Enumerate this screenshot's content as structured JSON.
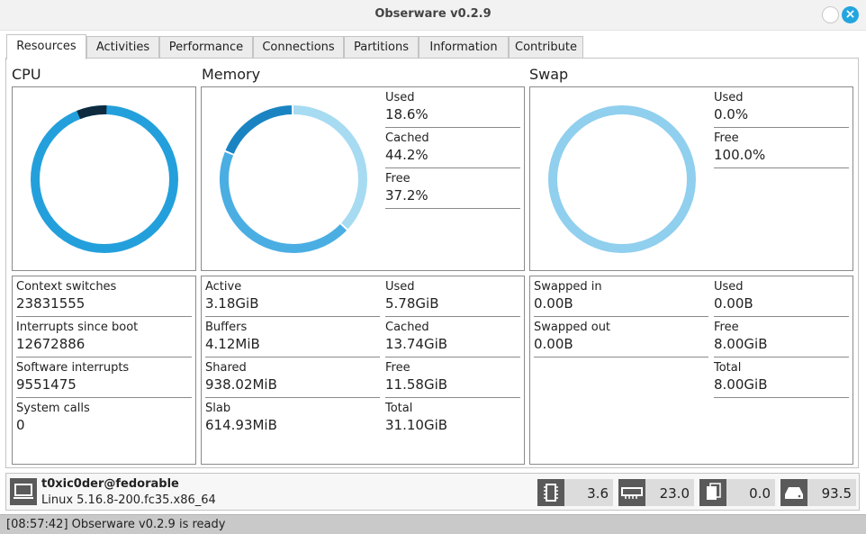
{
  "window": {
    "title": "Obserware v0.2.9",
    "close_glyph": "×"
  },
  "tabs": [
    {
      "label": "Resources",
      "active": true
    },
    {
      "label": "Activities"
    },
    {
      "label": "Performance"
    },
    {
      "label": "Connections"
    },
    {
      "label": "Partitions"
    },
    {
      "label": "Information"
    },
    {
      "label": "Contribute"
    }
  ],
  "cpu": {
    "title": "CPU",
    "ring_colors": [
      "#23a0dc",
      "#0e2a3f"
    ],
    "stats": [
      {
        "label": "Context switches",
        "value": "23831555"
      },
      {
        "label": "Interrupts since boot",
        "value": "12672886"
      },
      {
        "label": "Software interrupts",
        "value": "9551475"
      },
      {
        "label": "System calls",
        "value": "0"
      }
    ]
  },
  "memory": {
    "title": "Memory",
    "legend": [
      {
        "label": "Used",
        "value": "18.6%"
      },
      {
        "label": "Cached",
        "value": "44.2%"
      },
      {
        "label": "Free",
        "value": "37.2%"
      }
    ],
    "segments": [
      {
        "name": "Free",
        "percent": 37.2,
        "color": "#a7dbf2"
      },
      {
        "name": "Cached",
        "percent": 44.2,
        "color": "#4aaee3"
      },
      {
        "name": "Used",
        "percent": 18.6,
        "color": "#1a84c2"
      }
    ],
    "stats_left": [
      {
        "label": "Active",
        "value": "3.18GiB"
      },
      {
        "label": "Buffers",
        "value": "4.12MiB"
      },
      {
        "label": "Shared",
        "value": "938.02MiB"
      },
      {
        "label": "Slab",
        "value": "614.93MiB"
      }
    ],
    "stats_right": [
      {
        "label": "Used",
        "value": "5.78GiB"
      },
      {
        "label": "Cached",
        "value": "13.74GiB"
      },
      {
        "label": "Free",
        "value": "11.58GiB"
      },
      {
        "label": "Total",
        "value": "31.10GiB"
      }
    ]
  },
  "swap": {
    "title": "Swap",
    "legend": [
      {
        "label": "Used",
        "value": "0.0%"
      },
      {
        "label": "Free",
        "value": "100.0%"
      }
    ],
    "ring_color": "#90cfee",
    "stats_left": [
      {
        "label": "Swapped in",
        "value": "0.00B"
      },
      {
        "label": "Swapped out",
        "value": "0.00B"
      }
    ],
    "stats_right": [
      {
        "label": "Used",
        "value": "0.00B"
      },
      {
        "label": "Free",
        "value": "8.00GiB"
      },
      {
        "label": "Total",
        "value": "8.00GiB"
      }
    ]
  },
  "host": {
    "user": "t0xic0der@fedorable",
    "kernel": "Linux 5.16.8-200.fc35.x86_64",
    "icon": "computer-icon"
  },
  "metrics": [
    {
      "icon": "cpu-chip-icon",
      "value": "3.6"
    },
    {
      "icon": "memory-module-icon",
      "value": "23.0"
    },
    {
      "icon": "swap-pages-icon",
      "value": "0.0"
    },
    {
      "icon": "disk-drive-icon",
      "value": "93.5"
    }
  ],
  "status": {
    "text": "[08:57:42] Obserware v0.2.9 is ready"
  }
}
